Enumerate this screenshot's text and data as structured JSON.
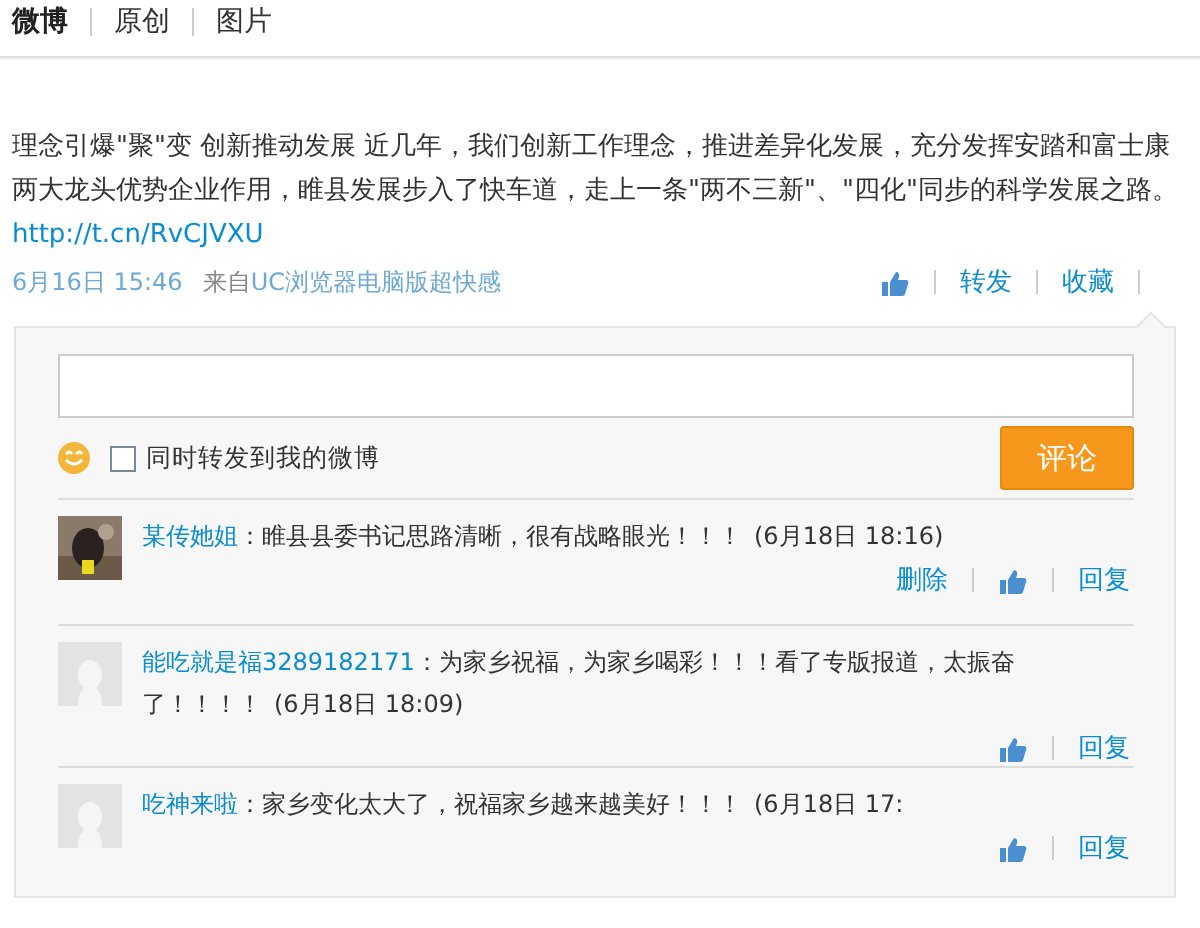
{
  "tabs": [
    {
      "label": "微博",
      "selected": true
    },
    {
      "label": "原创",
      "selected": false
    },
    {
      "label": "图片",
      "selected": false
    }
  ],
  "post": {
    "text": "理念引爆\"聚\"变 创新推动发展 近几年，我们创新工作理念，推进差异化发展，充分发挥安踏和富士康两大龙头优势企业作用，睢县发展步入了快车道，走上一条\"两不三新\"、\"四化\"同步的科学发展之路。",
    "link": "http://t.cn/RvCJVXU",
    "time": "6月16日 15:46",
    "source_prefix": "来自",
    "source": "UC浏览器电脑版超快感",
    "actions": [
      {
        "kind": "like"
      },
      {
        "kind": "link",
        "label": "转发"
      },
      {
        "kind": "link",
        "label": "收藏"
      }
    ]
  },
  "comment_box": {
    "forward_label": "同时转发到我的微博",
    "forward_checked": false,
    "submit": "评论"
  },
  "comments": [
    {
      "author": "某传她姐",
      "text": "：睢县县委书记思路清晰，很有战略眼光！！！",
      "time": "(6月18日 18:16)",
      "actions": [
        {
          "kind": "link",
          "label": "删除"
        },
        {
          "kind": "like"
        },
        {
          "kind": "link",
          "label": "回复"
        }
      ]
    },
    {
      "avatar": {
        "kind": "default"
      },
      "author": "能吃就是福3289182171",
      "text": "：为家乡祝福，为家乡喝彩！！！看了专版报道，太振奋了！！！！",
      "time": "(6月18日 18:09)",
      "actions": [
        {
          "kind": "like"
        },
        {
          "kind": "link",
          "label": "回复"
        }
      ]
    },
    {
      "avatar": {
        "kind": "default"
      },
      "author": "吃神来啦",
      "text": "：家乡变化太大了，祝福家乡越来越美好！！！",
      "time": "(6月18日 17:",
      "actions": [
        {
          "kind": "like"
        },
        {
          "kind": "link",
          "label": "回复"
        }
      ]
    }
  ]
}
